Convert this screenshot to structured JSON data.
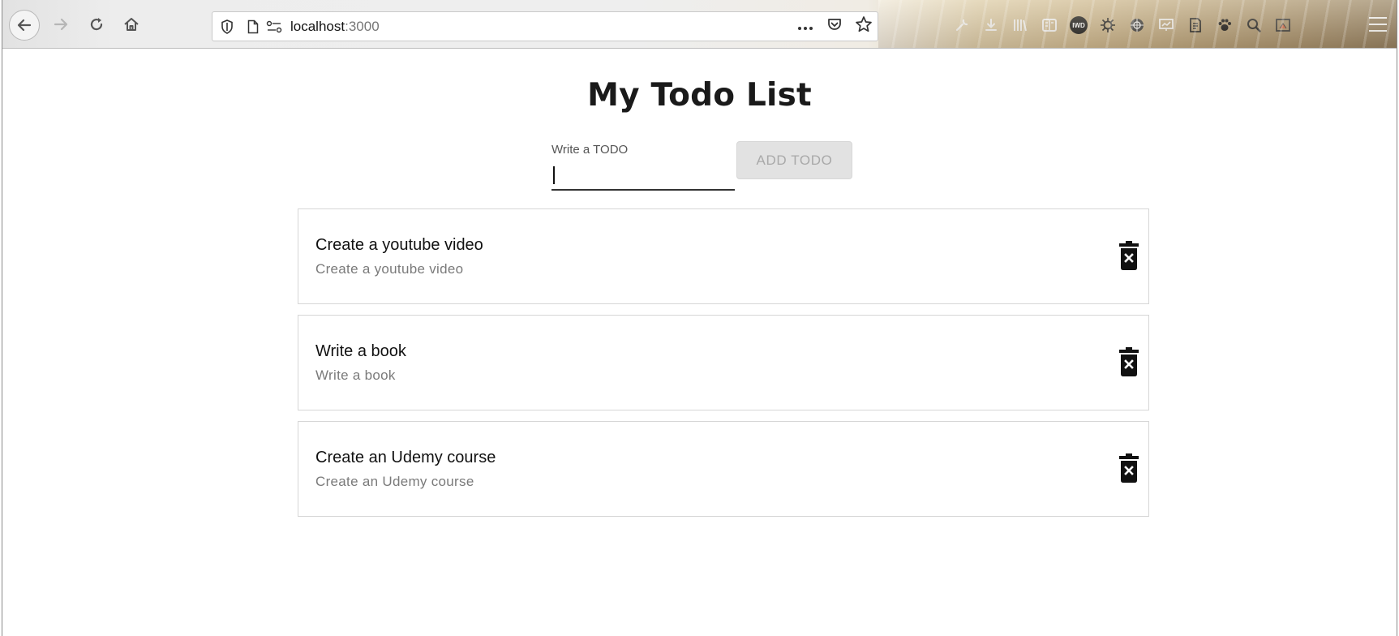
{
  "browser": {
    "url_host": "localhost",
    "url_port": ":3000",
    "nav": {
      "back_icon": "back-arrow-icon",
      "forward_icon": "forward-arrow-icon",
      "reload_icon": "reload-icon",
      "home_icon": "home-icon"
    },
    "url_bar_icons": [
      "shield-icon",
      "page-icon",
      "permissions-icon"
    ],
    "url_bar_right_icons": [
      "more-icon",
      "pocket-icon",
      "bookmark-star-icon"
    ],
    "extensions": [
      "wrench-icon",
      "download-icon",
      "library-icon",
      "reader-icon",
      "iwd-icon",
      "virus-icon",
      "globe-icon",
      "presentation-icon",
      "notes-icon",
      "paw-icon",
      "search-icon",
      "screenshot-icon"
    ],
    "extension_badge_text": "IWD",
    "accent": "#8f7b5d"
  },
  "page": {
    "title": "My Todo List",
    "input": {
      "label": "Write a TODO",
      "value": "",
      "placeholder": ""
    },
    "add_button_label": "ADD TODO",
    "todos": [
      {
        "primary": "Create a youtube video",
        "secondary": "Create a youtube video"
      },
      {
        "primary": "Write a book",
        "secondary": "Write a book"
      },
      {
        "primary": "Create an Udemy course",
        "secondary": "Create an Udemy course"
      }
    ],
    "delete_icon": "delete-trash-icon"
  },
  "colors": {
    "title": "#1a1a1a",
    "secondary_text": "#7a7a7a",
    "button_disabled_bg": "#e2e2e2",
    "button_disabled_text": "#a9a9a9",
    "card_border": "#d6d6d6"
  }
}
